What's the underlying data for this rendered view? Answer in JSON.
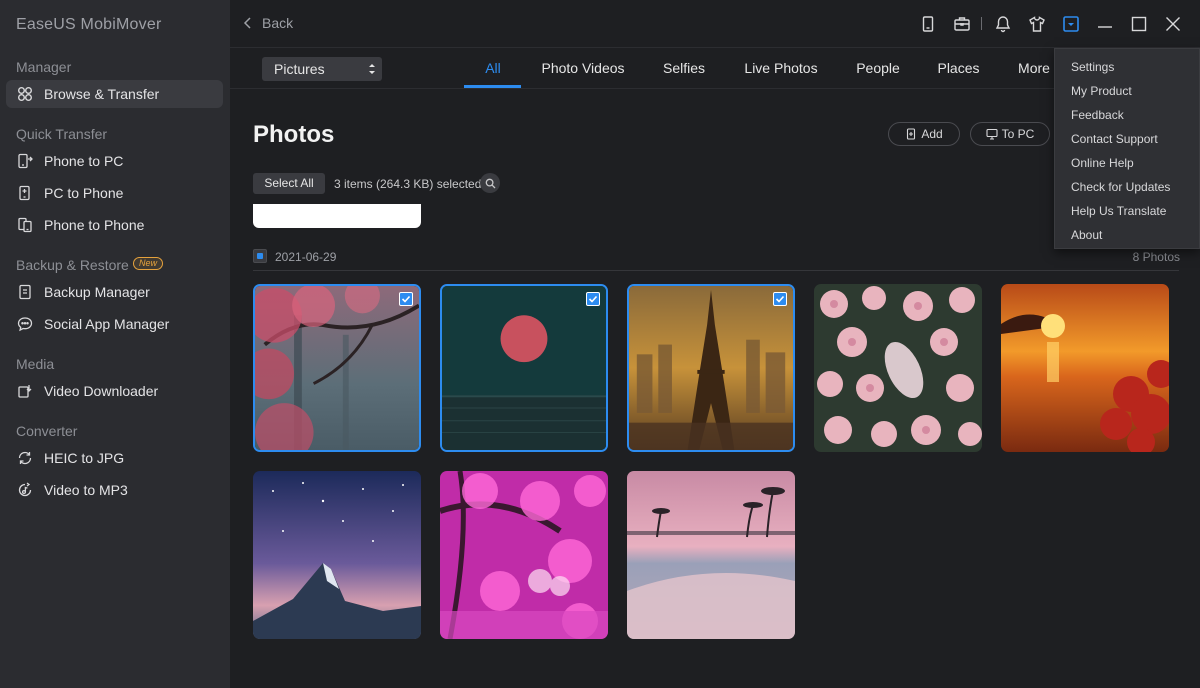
{
  "app": {
    "title": "EaseUS MobiMover"
  },
  "sidebar": {
    "sections": [
      {
        "title": "Manager",
        "items": [
          {
            "label": "Browse & Transfer",
            "icon": "grid-icon",
            "active": true
          }
        ]
      },
      {
        "title": "Quick Transfer",
        "items": [
          {
            "label": "Phone to PC",
            "icon": "phone-to-pc-icon"
          },
          {
            "label": "PC to Phone",
            "icon": "pc-to-phone-icon"
          },
          {
            "label": "Phone to Phone",
            "icon": "phone-to-phone-icon"
          }
        ]
      },
      {
        "title": "Backup & Restore",
        "badge": "New",
        "items": [
          {
            "label": "Backup Manager",
            "icon": "backup-icon"
          },
          {
            "label": "Social App Manager",
            "icon": "chat-icon"
          }
        ]
      },
      {
        "title": "Media",
        "items": [
          {
            "label": "Video Downloader",
            "icon": "download-icon"
          }
        ]
      },
      {
        "title": "Converter",
        "items": [
          {
            "label": "HEIC to JPG",
            "icon": "convert-icon"
          },
          {
            "label": "Video to MP3",
            "icon": "music-convert-icon"
          }
        ]
      }
    ]
  },
  "topbar": {
    "back_label": "Back",
    "icons": [
      "device-icon",
      "toolbox-icon",
      "bell-icon",
      "tshirt-icon",
      "menu-dropdown-icon",
      "minimize-icon",
      "maximize-icon",
      "close-icon"
    ]
  },
  "filter": {
    "select_value": "Pictures",
    "tabs": [
      "All",
      "Photo Videos",
      "Selfies",
      "Live Photos",
      "People",
      "Places",
      "More"
    ],
    "active_tab": "All"
  },
  "main": {
    "title": "Photos",
    "add_label": "Add",
    "to_pc_label": "To PC",
    "select_all_label": "Select All",
    "selection_info": "3 items (264.3 KB) selected",
    "date": "2021-06-29",
    "count": "8 Photos"
  },
  "photos": [
    {
      "name": "pink-tree-forest",
      "selected": true
    },
    {
      "name": "red-sun-over-sea",
      "selected": true
    },
    {
      "name": "eiffel-tower",
      "selected": true
    },
    {
      "name": "pink-flowers",
      "selected": false
    },
    {
      "name": "sunset-lake",
      "selected": false
    },
    {
      "name": "starry-mountain",
      "selected": false
    },
    {
      "name": "pink-blossom-tree",
      "selected": false
    },
    {
      "name": "pink-beach",
      "selected": false
    }
  ],
  "dropdown": {
    "items": [
      "Settings",
      "My Product",
      "Feedback",
      "Contact Support",
      "Online Help",
      "Check for Updates",
      "Help Us Translate",
      "About"
    ]
  },
  "colors": {
    "accent": "#2d8cf0",
    "badge": "#e6a23c",
    "sidebar_bg": "#2b2c30",
    "main_bg": "#1e1f22"
  }
}
